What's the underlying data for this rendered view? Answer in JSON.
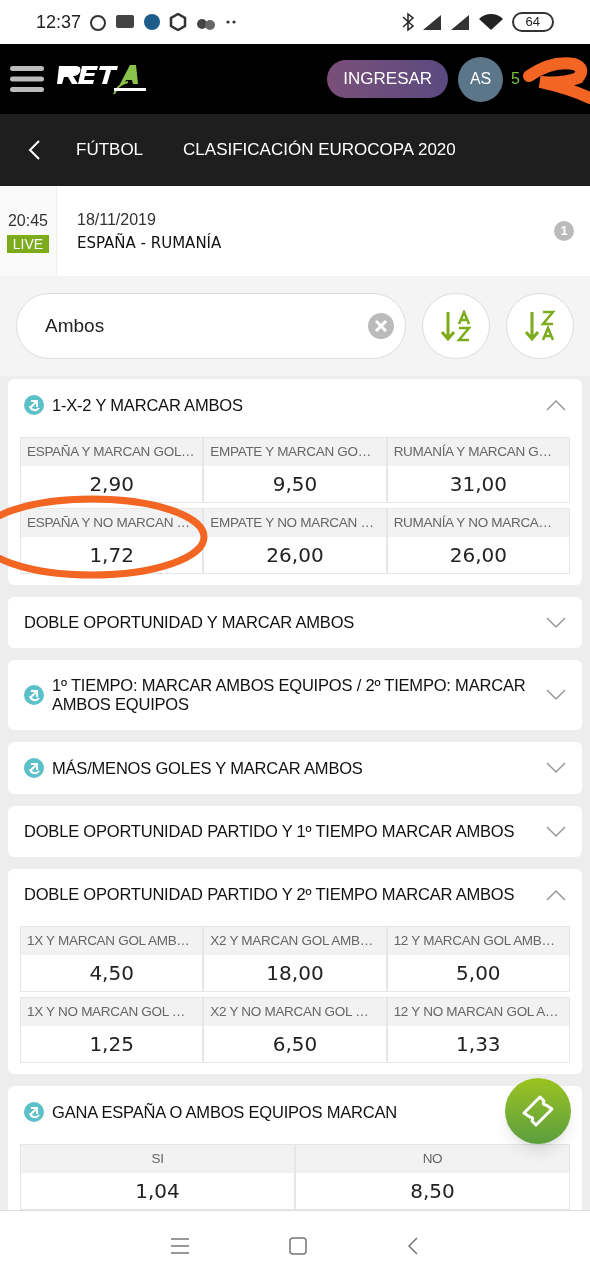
{
  "status_bar": {
    "time": "12:37",
    "battery": "64"
  },
  "header": {
    "login_button": "INGRESAR",
    "avatar": "AS",
    "balance": "5"
  },
  "breadcrumb": {
    "sport": "FÚTBOL",
    "competition": "CLASIFICACIÓN EUROCOPA 2020"
  },
  "event": {
    "time": "20:45",
    "live_badge": "LIVE",
    "date": "18/11/2019",
    "teams": "ESPAÑA - RUMANÍA",
    "info_badge": "1"
  },
  "search": {
    "value": "Ambos"
  },
  "markets": [
    {
      "title": "1-X-2 Y MARCAR AMBOS",
      "cashout": true,
      "expanded": true,
      "rows": [
        [
          {
            "label": "ESPAÑA Y MARCAN GOL…",
            "odds": "2,90"
          },
          {
            "label": "EMPATE Y MARCAN GO…",
            "odds": "9,50"
          },
          {
            "label": "RUMANÍA Y MARCAN G…",
            "odds": "31,00"
          }
        ],
        [
          {
            "label": "ESPAÑA Y NO MARCAN …",
            "odds": "1,72"
          },
          {
            "label": "EMPATE Y NO MARCAN …",
            "odds": "26,00"
          },
          {
            "label": "RUMANÍA Y NO MARCA…",
            "odds": "26,00"
          }
        ]
      ]
    },
    {
      "title": "DOBLE OPORTUNIDAD Y MARCAR AMBOS",
      "cashout": false,
      "expanded": false
    },
    {
      "title": "1º TIEMPO: MARCAR AMBOS EQUIPOS / 2º TIEMPO: MARCAR AMBOS EQUIPOS",
      "cashout": true,
      "expanded": false
    },
    {
      "title": "MÁS/MENOS GOLES Y MARCAR AMBOS",
      "cashout": true,
      "expanded": false
    },
    {
      "title": "DOBLE OPORTUNIDAD PARTIDO Y 1º TIEMPO MARCAR AMBOS",
      "cashout": false,
      "expanded": false
    },
    {
      "title": "DOBLE OPORTUNIDAD PARTIDO Y 2º TIEMPO MARCAR AMBOS",
      "cashout": false,
      "expanded": true,
      "rows": [
        [
          {
            "label": "1X Y MARCAN GOL AMB…",
            "odds": "4,50"
          },
          {
            "label": "X2 Y MARCAN GOL AMB…",
            "odds": "18,00"
          },
          {
            "label": "12 Y MARCAN GOL AMB…",
            "odds": "5,00"
          }
        ],
        [
          {
            "label": "1X Y NO MARCAN GOL …",
            "odds": "1,25"
          },
          {
            "label": "X2 Y NO MARCAN GOL …",
            "odds": "6,50"
          },
          {
            "label": "12 Y NO MARCAN GOL A…",
            "odds": "1,33"
          }
        ]
      ]
    },
    {
      "title": "GANA ESPAÑA O AMBOS EQUIPOS MARCAN",
      "cashout": true,
      "rows": [
        [
          {
            "label": "SI",
            "odds": "1,04"
          },
          {
            "label": "NO",
            "odds": "8,50"
          }
        ]
      ]
    }
  ]
}
